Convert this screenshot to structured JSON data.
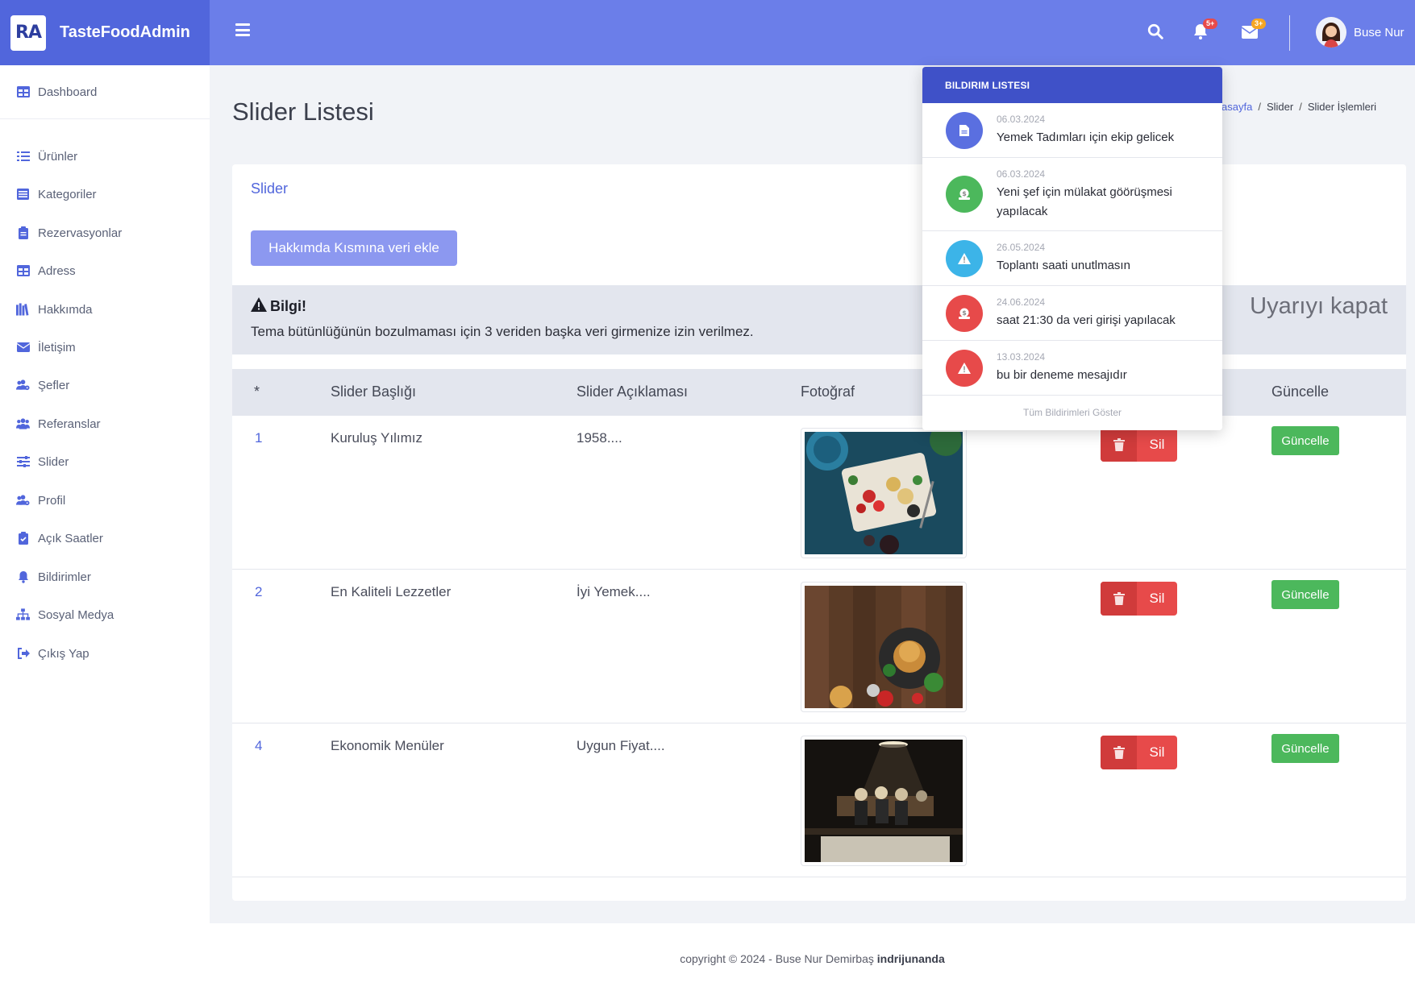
{
  "brand": {
    "logo": "RA",
    "name": "TasteFoodAdmin"
  },
  "topbar": {
    "notifications_badge": "5+",
    "messages_badge": "3+",
    "user_name": "Buse Nur"
  },
  "sidebar": {
    "dashboard": "Dashboard",
    "items": [
      {
        "label": "Ürünler",
        "icon": "list-icon"
      },
      {
        "label": "Kategoriler",
        "icon": "list-alt-icon"
      },
      {
        "label": "Rezervasyonlar",
        "icon": "clipboard-icon"
      },
      {
        "label": "Adress",
        "icon": "table-icon"
      },
      {
        "label": "Hakkımda",
        "icon": "book-icon"
      },
      {
        "label": "İletişim",
        "icon": "envelope-icon"
      },
      {
        "label": "Şefler",
        "icon": "users-cog-icon"
      },
      {
        "label": "Referanslar",
        "icon": "users-icon"
      },
      {
        "label": "Slider",
        "icon": "sliders-icon"
      },
      {
        "label": "Profil",
        "icon": "users-cog-icon"
      },
      {
        "label": "Açık Saatler",
        "icon": "clipboard-check-icon"
      },
      {
        "label": "Bildirimler",
        "icon": "bell-icon"
      },
      {
        "label": "Sosyal Medya",
        "icon": "sitemap-icon"
      },
      {
        "label": "Çıkış Yap",
        "icon": "sign-out-icon"
      }
    ]
  },
  "page": {
    "title": "Slider Listesi",
    "breadcrumb": [
      "asayfa",
      "Slider",
      "Slider İşlemleri"
    ]
  },
  "card": {
    "title": "Slider",
    "add_button": "Hakkımda Kısmına veri ekle",
    "alert": {
      "title": "Bilgi!",
      "text": "Tema bütünlüğünün bozulmaması için 3 veriden başka veri girmenize izin verilmez.",
      "close": "Uyarıyı kapat"
    },
    "table": {
      "headers": [
        "*",
        "Slider Başlığı",
        "Slider Açıklaması",
        "Fotoğraf",
        "Güncelle"
      ],
      "rows": [
        {
          "id": "1",
          "title": "Kuruluş Yılımız",
          "desc": "1958....",
          "delete": "Sil",
          "update": "Güncelle"
        },
        {
          "id": "2",
          "title": "En Kaliteli Lezzetler",
          "desc": "İyi Yemek....",
          "delete": "Sil",
          "update": "Güncelle"
        },
        {
          "id": "4",
          "title": "Ekonomik Menüler",
          "desc": "Uygun Fiyat....",
          "delete": "Sil",
          "update": "Güncelle"
        }
      ]
    }
  },
  "footer": {
    "text": "copyright © 2024 - Buse Nur Demirbaş ",
    "brand": "indrijunanda"
  },
  "notifications": {
    "header": "BILDIRIM LISTESI",
    "items": [
      {
        "date": "06.03.2024",
        "text": "Yemek Tadımları için ekip gelicek",
        "color": "#5a6fe0",
        "icon": "file-icon"
      },
      {
        "date": "06.03.2024",
        "text": "Yeni şef için mülakat göörüşmesi yapılacak",
        "color": "#4cb85c",
        "icon": "money-icon"
      },
      {
        "date": "26.05.2024",
        "text": "Toplantı saati unutlmasın",
        "color": "#3cb4e8",
        "icon": "warning-icon"
      },
      {
        "date": "24.06.2024",
        "text": "saat 21:30 da veri girişi yapılacak",
        "color": "#e74a4a",
        "icon": "money-icon"
      },
      {
        "date": "13.03.2024",
        "text": "bu bir deneme mesajıdır",
        "color": "#e74a4a",
        "icon": "warning-icon"
      }
    ],
    "footer": "Tüm Bildirimleri Göster"
  },
  "colors": {
    "topbar": "#6b7ee9",
    "brand": "#5166dc",
    "danger": "#e74a4a",
    "success": "#4cb85c"
  }
}
